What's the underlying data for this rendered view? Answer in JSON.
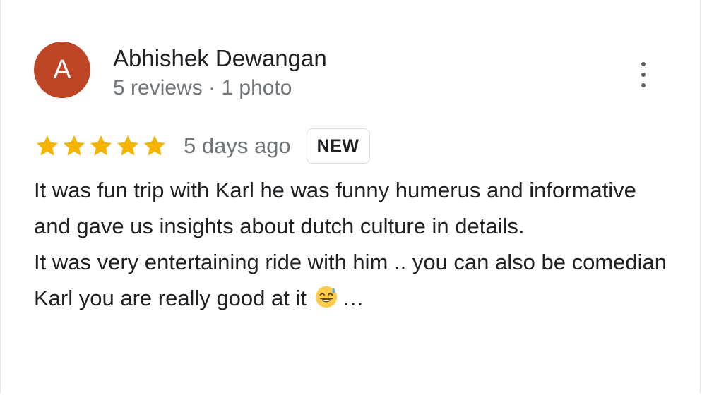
{
  "review": {
    "author": {
      "avatar_letter": "A",
      "avatar_color": "#bf4527",
      "name": "Abhishek Dewangan",
      "meta": "5 reviews · 1 photo"
    },
    "more_icon": "more-vertical-icon",
    "rating": 5,
    "star_color": "#f4b400",
    "date": "5 days ago",
    "badge": "NEW",
    "text_para1": "It was fun trip with Karl he was funny humerus and informative and gave us insights about dutch culture in details.",
    "text_para2": "It was very entertaining ride with him .. you can also be comedian Karl you are really good at it",
    "emoji_icon": "grinning-sweat-emoji",
    "truncation": "…"
  }
}
